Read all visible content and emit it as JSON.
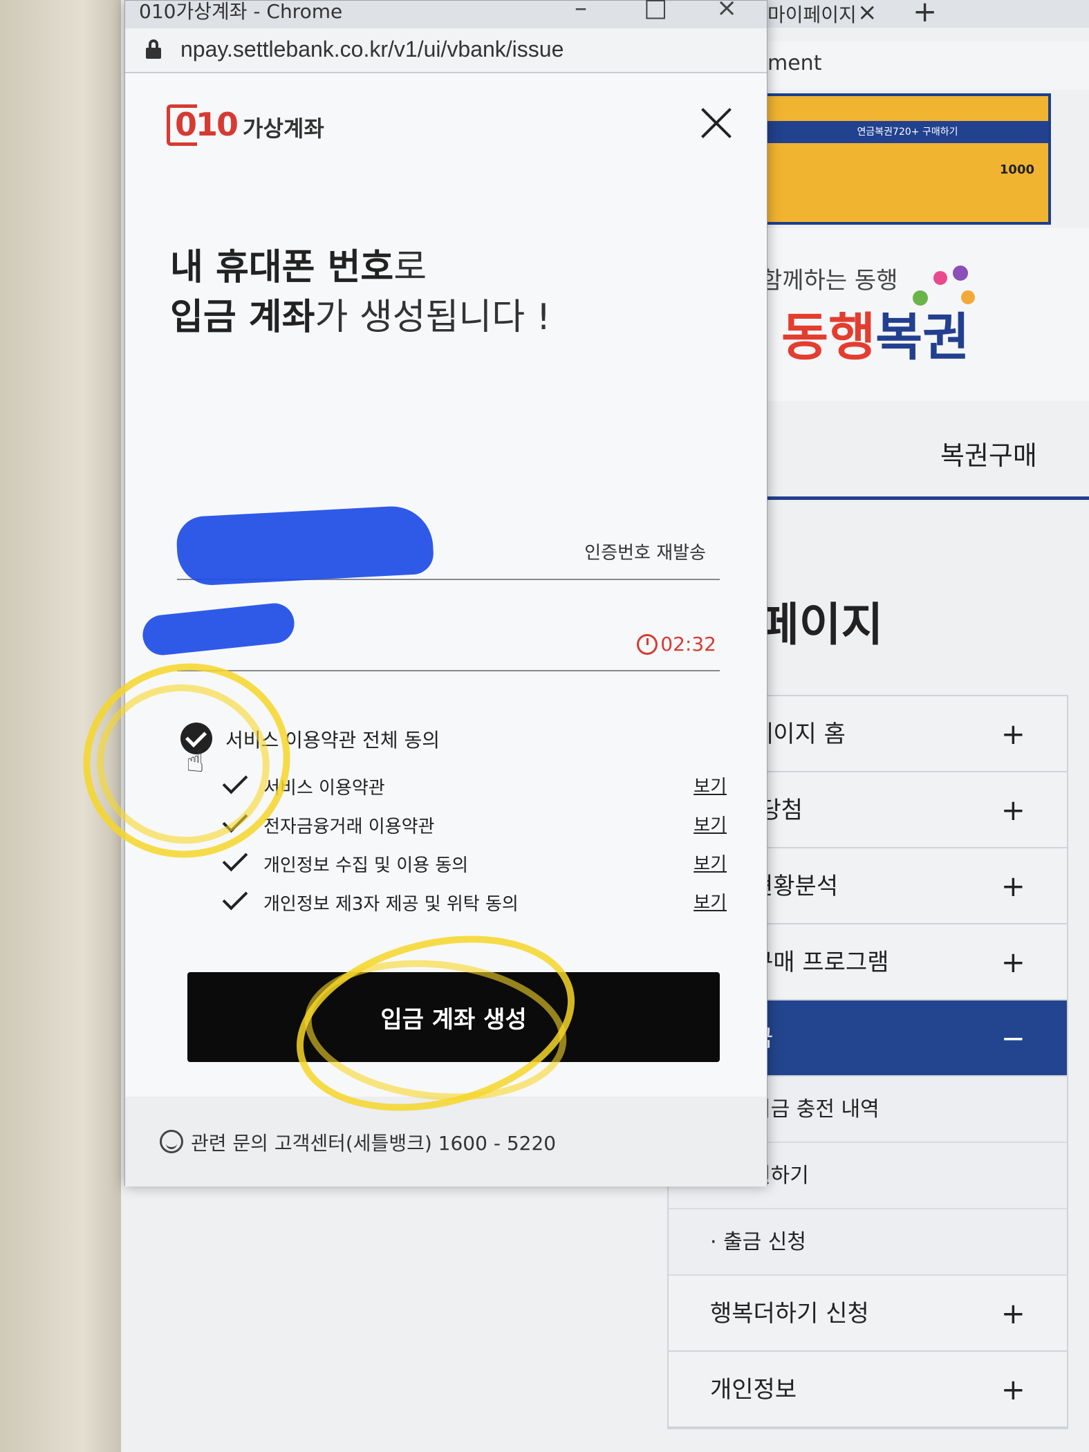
{
  "popup": {
    "window_title": "010가상계좌 - Chrome",
    "url": "npay.settlebank.co.kr/v1/ui/vbank/issue",
    "brand_number": "010",
    "brand_text": "가상계좌",
    "headline_line1_bold": "내 휴대폰 번호",
    "headline_line1_rest": "로",
    "headline_line2_bold": "입금 계좌",
    "headline_line2_rest": "가 생성됩니다 !",
    "resend_label": "인증번호 재발송",
    "timer": "02:32",
    "agree_all_label": "서비스 이용약관 전체 동의",
    "terms": [
      {
        "label": "서비스 이용약관",
        "view": "보기"
      },
      {
        "label": "전자금융거래 이용약관",
        "view": "보기"
      },
      {
        "label": "개인정보 수집 및 이용 동의",
        "view": "보기"
      },
      {
        "label": "개인정보 제3자 제공 및 위탁 동의",
        "view": "보기"
      }
    ],
    "issue_button": "입금 계좌 생성",
    "footer": "관련 문의 고객센터(세틀뱅크) 1600 - 5220",
    "accent_color": "#d53b32"
  },
  "background": {
    "tab_title": "마이페이지",
    "tab_close": "×",
    "new_tab": "+",
    "addr_fragment": "ment",
    "banner_title": "연금복권720+ 구매하기",
    "banner_amount": "1000",
    "logo_sub": "함께하는 동행",
    "logo_part1": "동행",
    "logo_part2": "복권",
    "nav_item": "복권구매",
    "page_title": "페이지",
    "menu": [
      {
        "label": "페이지 홈",
        "icon": "+"
      },
      {
        "label": "/당첨",
        "icon": "+"
      },
      {
        "label": "현황분석",
        "icon": "+"
      },
      {
        "label": "구매 프로그램",
        "icon": "+"
      },
      {
        "label": "금",
        "icon": "−"
      }
    ],
    "submenu": [
      "치금 충전 내역",
      "전하기",
      "· 출금 신청"
    ],
    "menu_bottom": [
      {
        "label": "행복더하기 신청",
        "icon": "+"
      },
      {
        "label": "개인정보",
        "icon": "+"
      }
    ],
    "brand_blue": "#23458f"
  }
}
